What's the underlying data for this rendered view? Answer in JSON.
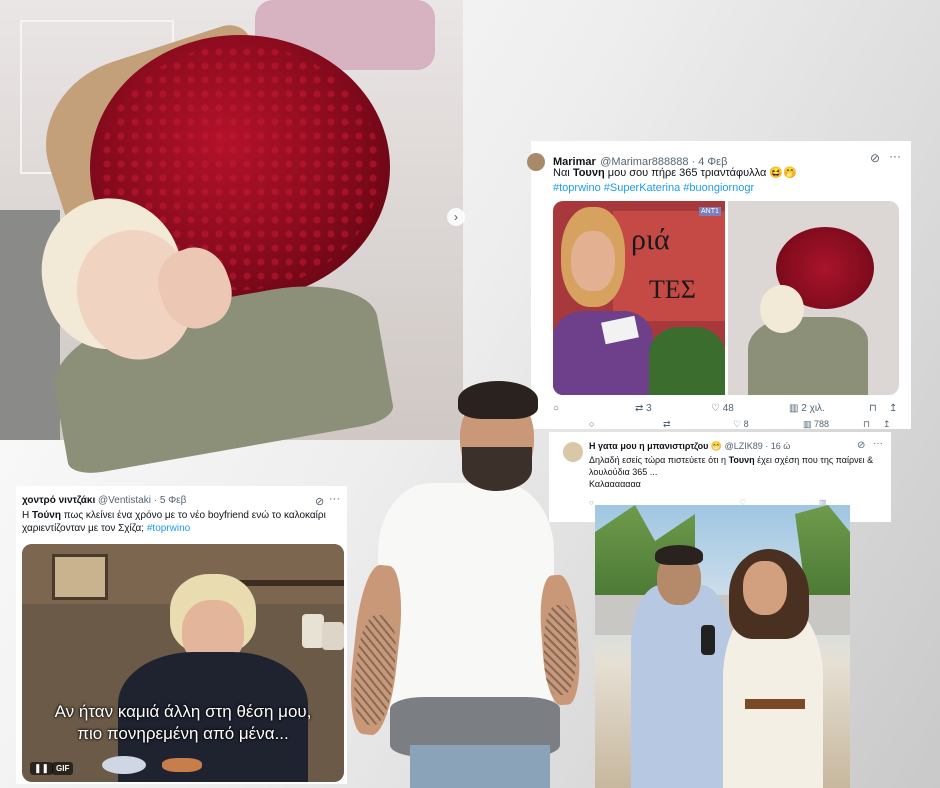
{
  "tweet1": {
    "name": "Marimar",
    "handle": "@Marimar888888 · 4 Φεβ",
    "text_pre": "Ναι ",
    "text_bold": "Τουνη",
    "text_post": " μου σου πήρε 365 τριαντάφυλλα 😆🤭",
    "hashtags": "#toprwino #SuperKaterina #buongiornogr",
    "media_left_sign": "ριά",
    "media_left_sign2": "ΤΕΣ",
    "media_logo": "ΑΝΤ1",
    "actions": {
      "reply": "",
      "retweet": "3",
      "like": "48",
      "views": "2 χιλ."
    },
    "actions_second": {
      "like": "8",
      "views": "788"
    }
  },
  "tweet2": {
    "name": "Η γατα μου η μπανιστιρτζου 😁",
    "handle": "@LZIK89 · 16 ώ",
    "text_pre": "Δηλαδή εσείς τώρα πιστεύετε ότι η ",
    "text_bold": "Τουνη",
    "text_post": " έχει σχέση που της παίρνει & λουλούδια 365 ...",
    "text_line2": "Καλααααααα"
  },
  "tweet3": {
    "name": "χοντρό νιντζάκι",
    "handle": "@Ventistaki · 5 Φεβ",
    "text_pre": "Η ",
    "text_bold": "Τούνη",
    "text_post": " πως κλείνει ένα χρόνο με το νέο boyfriend ενώ το καλοκαίρι χαριεντίζονταν με τον Σχίζα; ",
    "hashtag": "#toprwino",
    "subtitle_line1": "Αν ήταν καμιά άλλη στη θέση μου,",
    "subtitle_line2": "πιο πονηρεμένη από μένα...",
    "gif_badge": "GIF",
    "pause_icon": "pause-icon"
  },
  "colors": {
    "link": "#1d9bf0",
    "roses": "#8e0c1f",
    "muted": "#536471"
  }
}
